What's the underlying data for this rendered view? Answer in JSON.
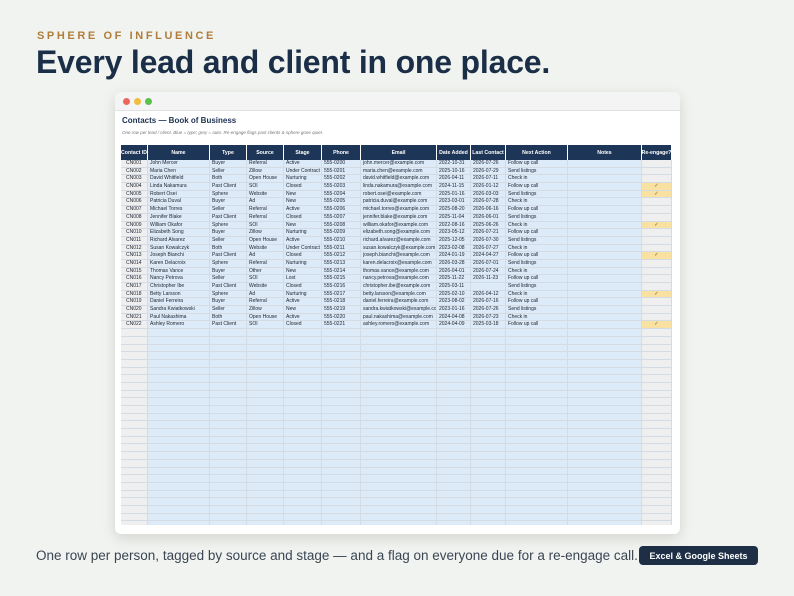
{
  "eyebrow": "SPHERE OF INFLUENCE",
  "headline": "Every lead and client in one place.",
  "caption": "One row per person, tagged by source and stage — and a flag on everyone due for a re-engage call.",
  "badge": "Excel & Google Sheets",
  "sheet": {
    "title": "Contacts — Book of Business",
    "subtitle": "One row per lead / client. Blue = type; grey = auto. Re-engage flags past clients & sphere gone quiet.",
    "columns": [
      "Contact ID",
      "Name",
      "Type",
      "Source",
      "Stage",
      "Phone",
      "Email",
      "Date Added",
      "Last Contact",
      "Next Action",
      "Notes",
      "Re-engage?"
    ],
    "rows": [
      [
        "CN001",
        "John Mercer",
        "Buyer",
        "Referral",
        "Active",
        "555-0200",
        "john.mercer@example.com",
        "2022-10-31",
        "2026-07-26",
        "Follow up call",
        "",
        ""
      ],
      [
        "CN002",
        "Maria Chen",
        "Seller",
        "Zillow",
        "Under Contract",
        "555-0201",
        "maria.chen@example.com",
        "2025-10-16",
        "2026-07-29",
        "Send listings",
        "",
        ""
      ],
      [
        "CN003",
        "David Whitfield",
        "Both",
        "Open House",
        "Nurturing",
        "555-0202",
        "david.whitfield@example.com",
        "2026-04-11",
        "2026-07-11",
        "Check in",
        "",
        ""
      ],
      [
        "CN004",
        "Linda Nakamura",
        "Past Client",
        "SOI",
        "Closed",
        "555-0203",
        "linda.nakamura@example.com",
        "2024-11-15",
        "2026-01-12",
        "Follow up call",
        "",
        "✓"
      ],
      [
        "CN005",
        "Robert Osei",
        "Sphere",
        "Website",
        "New",
        "555-0204",
        "robert.osei@example.com",
        "2025-01-16",
        "2026-03-03",
        "Send listings",
        "",
        "✓"
      ],
      [
        "CN006",
        "Patricia Duval",
        "Buyer",
        "Ad",
        "New",
        "555-0205",
        "patricia.duval@example.com",
        "2023-03-01",
        "2026-07-28",
        "Check in",
        "",
        ""
      ],
      [
        "CN007",
        "Michael Torres",
        "Seller",
        "Referral",
        "Active",
        "555-0206",
        "michael.torres@example.com",
        "2025-08-20",
        "2026-06-16",
        "Follow up call",
        "",
        ""
      ],
      [
        "CN008",
        "Jennifer Blake",
        "Past Client",
        "Referral",
        "Closed",
        "555-0207",
        "jennifer.blake@example.com",
        "2025-11-04",
        "2026-06-01",
        "Send listings",
        "",
        ""
      ],
      [
        "CN009",
        "William Okafor",
        "Sphere",
        "SOI",
        "New",
        "555-0208",
        "william.okafor@example.com",
        "2022-08-16",
        "2025-06-26",
        "Check in",
        "",
        "✓"
      ],
      [
        "CN010",
        "Elizabeth Song",
        "Buyer",
        "Zillow",
        "Nurturing",
        "555-0209",
        "elizabeth.song@example.com",
        "2023-05-12",
        "2026-07-21",
        "Follow up call",
        "",
        ""
      ],
      [
        "CN011",
        "Richard Alvarez",
        "Seller",
        "Open House",
        "Active",
        "555-0210",
        "richard.alvarez@example.com",
        "2025-12-05",
        "2026-07-30",
        "Send listings",
        "",
        ""
      ],
      [
        "CN012",
        "Susan Kowalczyk",
        "Both",
        "Website",
        "Under Contract",
        "555-0211",
        "susan.kowalczyk@example.com",
        "2023-02-08",
        "2026-07-27",
        "Check in",
        "",
        ""
      ],
      [
        "CN013",
        "Joseph Bianchi",
        "Past Client",
        "Ad",
        "Closed",
        "555-0212",
        "joseph.bianchi@example.com",
        "2024-01-19",
        "2024-04-27",
        "Follow up call",
        "",
        "✓"
      ],
      [
        "CN014",
        "Karen Delacroix",
        "Sphere",
        "Referral",
        "Nurturing",
        "555-0213",
        "karen.delacroix@example.com",
        "2026-03-28",
        "2026-07-01",
        "Send listings",
        "",
        ""
      ],
      [
        "CN015",
        "Thomas Vance",
        "Buyer",
        "Other",
        "New",
        "555-0214",
        "thomas.vance@example.com",
        "2026-04-01",
        "2026-07-24",
        "Check in",
        "",
        ""
      ],
      [
        "CN016",
        "Nancy Petrova",
        "Seller",
        "SOI",
        "Lost",
        "555-0215",
        "nancy.petrova@example.com",
        "2025-11-22",
        "2026-11-23",
        "Follow up call",
        "",
        ""
      ],
      [
        "CN017",
        "Christopher Ibe",
        "Past Client",
        "Website",
        "Closed",
        "555-0216",
        "christopher.ibe@example.com",
        "2025-03-11",
        "",
        "Send listings",
        "",
        ""
      ],
      [
        "CN018",
        "Betty Larsson",
        "Sphere",
        "Ad",
        "Nurturing",
        "555-0217",
        "betty.larsson@example.com",
        "2025-02-10",
        "2026-04-12",
        "Check in",
        "",
        "✓"
      ],
      [
        "CN019",
        "Daniel Ferreira",
        "Buyer",
        "Referral",
        "Active",
        "555-0218",
        "daniel.ferreira@example.com",
        "2023-08-02",
        "2026-07-16",
        "Follow up call",
        "",
        ""
      ],
      [
        "CN020",
        "Sandra Kwiatkowski",
        "Seller",
        "Zillow",
        "New",
        "555-0219",
        "sandra.kwiatkowski@example.com",
        "2023-01-16",
        "2026-07-26",
        "Send listings",
        "",
        ""
      ],
      [
        "CN021",
        "Paul Nakashima",
        "Both",
        "Open House",
        "Active",
        "555-0220",
        "paul.nakashima@example.com",
        "2024-04-08",
        "2026-07-23",
        "Check in",
        "",
        ""
      ],
      [
        "CN022",
        "Ashley Romero",
        "Past Client",
        "SOI",
        "Closed",
        "555-0221",
        "ashley.romero@example.com",
        "2024-04-09",
        "2025-03-18",
        "Follow up call",
        "",
        "✓"
      ]
    ]
  }
}
